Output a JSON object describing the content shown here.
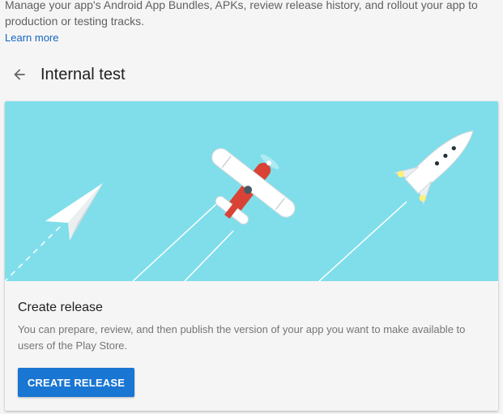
{
  "intro": {
    "text": "Manage your app's Android App Bundles, APKs, review release history, and rollout your app to production or testing tracks.",
    "learn_more": "Learn more"
  },
  "header": {
    "back_icon": "arrow-left-icon",
    "title": "Internal test"
  },
  "card": {
    "illustration_icons": [
      "paper-plane-icon",
      "airplane-icon",
      "rocket-icon"
    ],
    "title": "Create release",
    "description": "You can prepare, review, and then publish the version of your app you want to make available to users of the Play Store.",
    "button_label": "CREATE RELEASE"
  },
  "colors": {
    "accent": "#1976d2",
    "link": "#1565c0",
    "illustration_bg": "#80deea",
    "plane_red": "#d84335"
  }
}
